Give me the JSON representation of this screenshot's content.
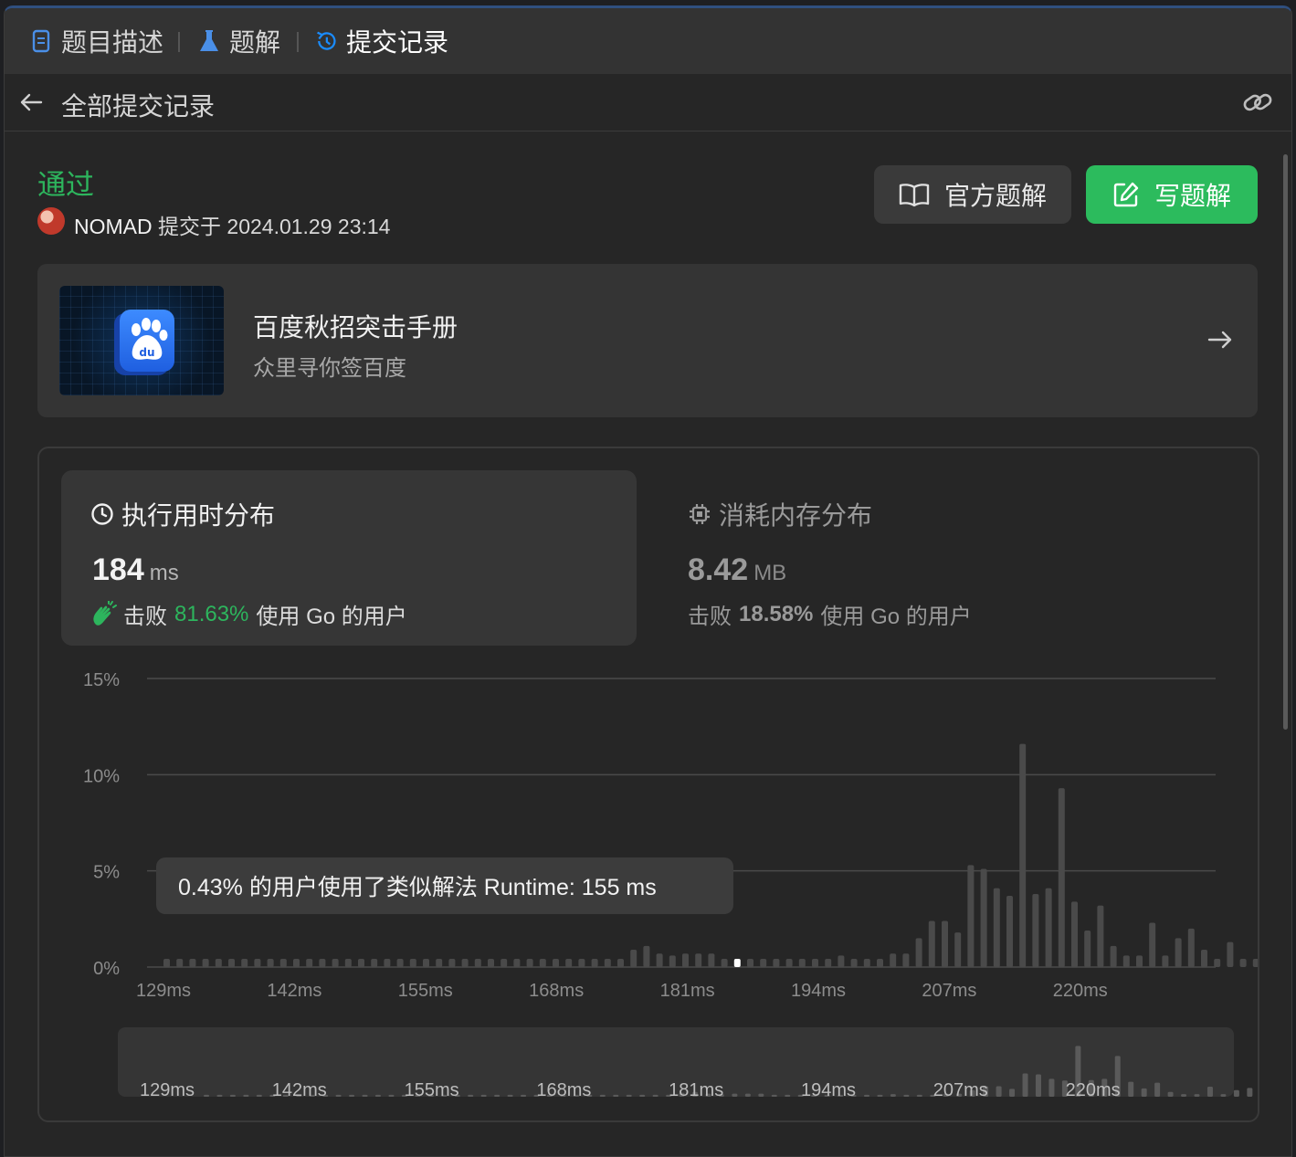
{
  "tabs": [
    {
      "label": "题目描述",
      "icon": "description-icon",
      "active": false
    },
    {
      "label": "题解",
      "icon": "flask-icon",
      "active": false
    },
    {
      "label": "提交记录",
      "icon": "history-icon",
      "active": true
    }
  ],
  "subheader": {
    "title": "全部提交记录",
    "back_icon": "arrow-left-icon",
    "link_icon": "link-icon"
  },
  "submission": {
    "status": "通过",
    "user": "NOMAD",
    "submitted_text": "提交于",
    "datetime": "2024.01.29 23:14",
    "status_color": "#2db55d"
  },
  "actions": {
    "official_solution": "官方题解",
    "write_solution": "写题解"
  },
  "promo": {
    "title": "百度秋招突击手册",
    "subtitle": "众里寻你签百度"
  },
  "runtime": {
    "title": "执行用时分布",
    "value": "184",
    "unit": "ms",
    "beat_prefix": "击败",
    "beat_pct": "81.63%",
    "beat_suffix": "使用 Go 的用户"
  },
  "memory": {
    "title": "消耗内存分布",
    "value": "8.42",
    "unit": "MB",
    "beat_prefix": "击败",
    "beat_pct": "18.58%",
    "beat_suffix": "使用 Go 的用户"
  },
  "tooltip": "0.43% 的用户使用了类似解法 Runtime: 155 ms",
  "chart_data": {
    "type": "bar",
    "ylabel": "",
    "xlabel": "",
    "ylim": [
      0,
      15
    ],
    "y_ticks": [
      "15%",
      "10%",
      "5%",
      "0%"
    ],
    "x_ticks": [
      "129ms",
      "142ms",
      "155ms",
      "168ms",
      "181ms",
      "194ms",
      "207ms",
      "220ms"
    ],
    "x_start_ms": 129,
    "x_step_ms": 1.3,
    "values": [
      0.43,
      0.43,
      0.43,
      0.43,
      0.43,
      0.43,
      0.43,
      0.43,
      0.43,
      0.43,
      0.43,
      0.43,
      0.43,
      0.43,
      0.43,
      0.43,
      0.43,
      0.43,
      0.43,
      0.43,
      0.43,
      0.43,
      0.43,
      0.43,
      0.43,
      0.43,
      0.43,
      0.43,
      0.43,
      0.43,
      0.43,
      0.43,
      0.43,
      0.43,
      0.43,
      0.43,
      0.9,
      1.1,
      0.7,
      0.6,
      0.7,
      0.7,
      0.7,
      0.43,
      0.43,
      0.43,
      0.43,
      0.43,
      0.43,
      0.43,
      0.43,
      0.43,
      0.6,
      0.43,
      0.43,
      0.43,
      0.7,
      0.7,
      1.5,
      2.4,
      2.4,
      1.8,
      5.3,
      5.1,
      4.1,
      3.7,
      11.6,
      3.8,
      4.1,
      9.3,
      3.4,
      1.9,
      3.2,
      1.1,
      0.6,
      0.6,
      2.3,
      0.6,
      1.5,
      2.0,
      0.9,
      0.43,
      1.3,
      0.43,
      0.43,
      0.43,
      0.43,
      0.43,
      0.43,
      0.43,
      0.43,
      0.43,
      0.43,
      0.43,
      0.43,
      0.43,
      0.43,
      0.43,
      0.43,
      0.43,
      0.43,
      0.43,
      0.43,
      0.43,
      0.43
    ],
    "highlight_index": 44,
    "bar_color": "#4a4a4a",
    "highlight_color": "#ffffff",
    "grid": true
  },
  "minimap": {
    "x_ticks": [
      "129ms",
      "142ms",
      "155ms",
      "168ms",
      "181ms",
      "194ms",
      "207ms",
      "220ms"
    ]
  }
}
